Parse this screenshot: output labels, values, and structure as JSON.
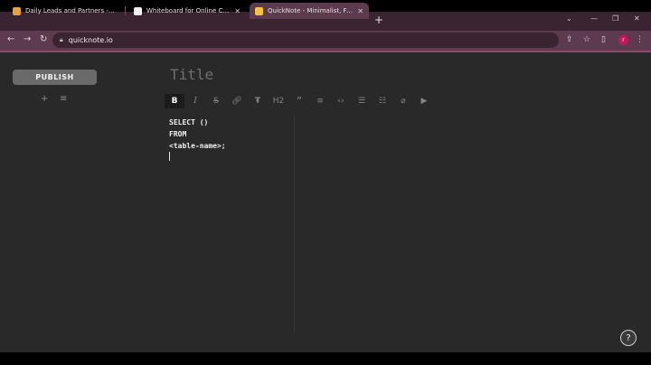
{
  "browser": {
    "tabs": [
      {
        "title": "Daily Leads and Partners - LeetC",
        "favicon_color": "#e6a23c"
      },
      {
        "title": "Whiteboard for Online Collabora",
        "favicon_color": "#f2f2f2"
      },
      {
        "title": "QuickNote - Minimalist, Free & A",
        "favicon_color": "#f5c542"
      }
    ],
    "url": "quicknote.io",
    "profile_initial": "r"
  },
  "sidebar": {
    "publish_label": "PUBLISH"
  },
  "editor": {
    "title_placeholder": "Title",
    "toolbar": {
      "heading_label": "H2"
    },
    "lines": [
      "SELECT ()",
      "FROM",
      "<table-name>;"
    ]
  },
  "help": {
    "label": "?"
  },
  "colors": {
    "tab_strip": "#3b2432",
    "active_tab": "#5b3b4d",
    "app_background": "#292929",
    "publish_button": "#6a6a6a"
  }
}
